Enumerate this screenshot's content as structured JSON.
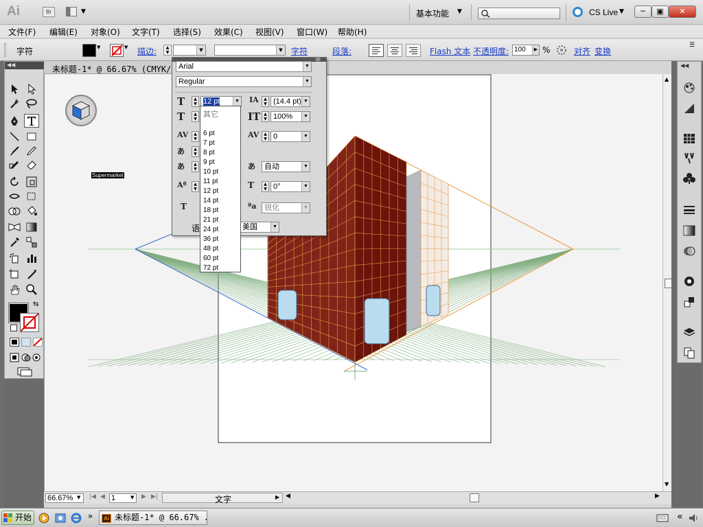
{
  "app": {
    "logo": "Ai",
    "bridge_button": "Br",
    "workspace": "基本功能",
    "cs_live": "CS Live",
    "window_buttons": [
      "─",
      "▣",
      "✕"
    ]
  },
  "menubar": [
    "文件(F)",
    "编辑(E)",
    "对象(O)",
    "文字(T)",
    "选择(S)",
    "效果(C)",
    "视图(V)",
    "窗口(W)",
    "帮助(H)"
  ],
  "controlbar": {
    "label": "字符",
    "stroke_label": "描边:",
    "character_link": "字符",
    "paragraph_link": "段落:",
    "flash_text": "Flash 文本",
    "opacity_label": "不透明度:",
    "opacity_value": "100",
    "opacity_unit": "%",
    "align_link": "对齐",
    "transform_link": "变换"
  },
  "document": {
    "tab_title": "未标题-1* @ 66.67% (CMYK/预览)",
    "canvas_label": "Supermarket",
    "colors": {
      "building_front": "#7a1a10",
      "building_side": "#8c2a18",
      "grid_orange": "#e79a3e",
      "grid_green": "#78a878",
      "grid_blue": "#3a6acc"
    }
  },
  "character_panel": {
    "font_family": "Arial",
    "font_style": "Regular",
    "font_size": "12 pt",
    "leading": "(14.4 pt)",
    "horizontal_scale": "100%",
    "tracking": "0",
    "baseline_value": "自动",
    "rotation": "0°",
    "antialias": "锐化",
    "language_prefix": "语",
    "language": "美国",
    "size_list": {
      "header": "其它",
      "options": [
        "6 pt",
        "7 pt",
        "8 pt",
        "9 pt",
        "10 pt",
        "11 pt",
        "12 pt",
        "14 pt",
        "18 pt",
        "21 pt",
        "24 pt",
        "36 pt",
        "48 pt",
        "60 pt",
        "72 pt"
      ]
    }
  },
  "statusbar": {
    "zoom": "66.67%",
    "artboard": "1",
    "tool_status": "文字"
  },
  "taskbar": {
    "start": "开始",
    "task_label": "未标题-1* @ 66.67% ..."
  }
}
